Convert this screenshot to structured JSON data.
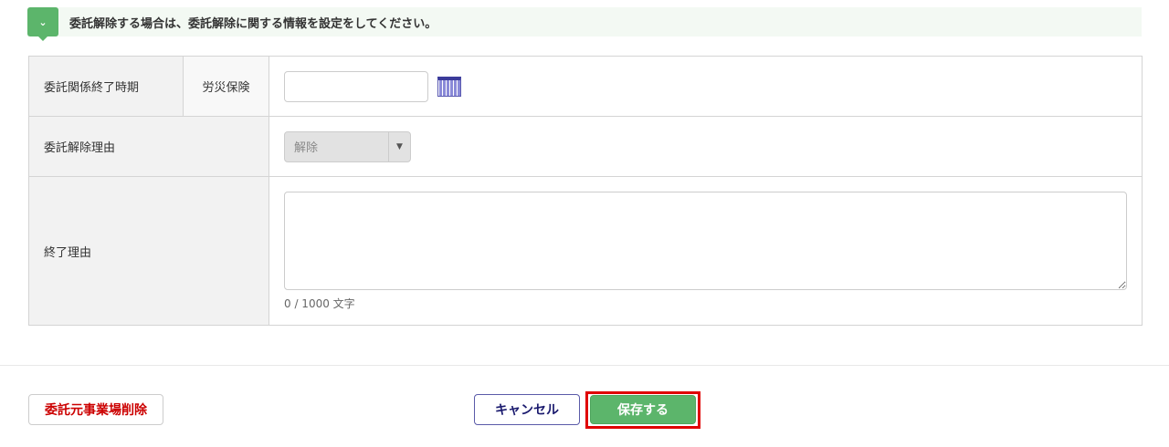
{
  "notice": {
    "text": "委託解除する場合は、委託解除に関する情報を設定をしてください。"
  },
  "form": {
    "end_period_label": "委託関係終了時期",
    "insurance_label": "労災保険",
    "date_value": "",
    "reason_label": "委託解除理由",
    "reason_value": "解除",
    "end_reason_label": "終了理由",
    "end_reason_value": "",
    "char_count": "0 / 1000 文字"
  },
  "footer": {
    "delete_label": "委託元事業場削除",
    "cancel_label": "キャンセル",
    "save_label": "保存する"
  }
}
